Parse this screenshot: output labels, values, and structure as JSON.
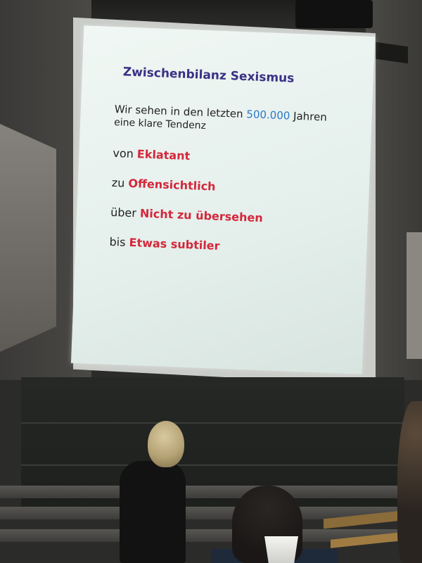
{
  "slide": {
    "title": "Zwischenbilanz Sexismus",
    "intro_line1_a": "Wir sehen in den letzten ",
    "intro_number": "500.000",
    "intro_line1_b": " Jahren",
    "intro_line2": "eine klare Tendenz",
    "steps": [
      {
        "prefix": "von ",
        "term": "Eklatant"
      },
      {
        "prefix": "zu ",
        "term": "Offensichtlich"
      },
      {
        "prefix": "über ",
        "term": "Nicht zu übersehen"
      },
      {
        "prefix": "bis ",
        "term": "Etwas subtiler"
      }
    ]
  },
  "colors": {
    "title": "#3a3185",
    "highlight_number": "#2a78c8",
    "highlight_term": "#d4263a"
  }
}
